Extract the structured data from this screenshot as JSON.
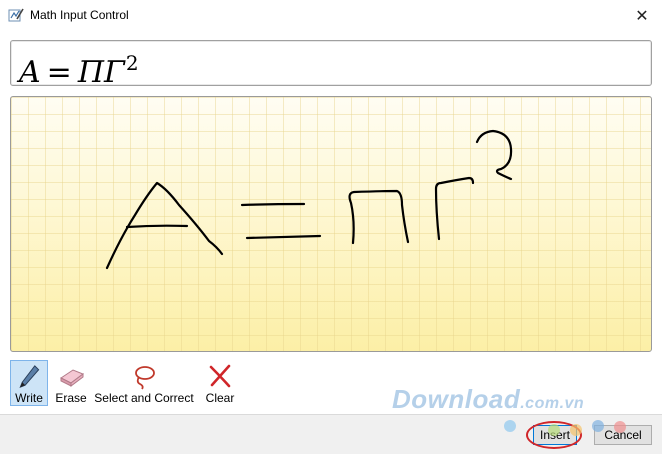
{
  "window": {
    "title": "Math Input Control",
    "close_glyph": "✕",
    "icons": [
      "math-input-app-icon",
      "close-icon"
    ]
  },
  "preview": {
    "var_a": "A",
    "equals": "=",
    "pi": "Π",
    "gamma": "Γ",
    "exponent": "2"
  },
  "handwriting": {
    "icon": "handwritten-ink-strokes",
    "ink_color": "#000000"
  },
  "toolbar": {
    "tools": [
      {
        "label": "Write",
        "icon": "pen-icon",
        "active": true
      },
      {
        "label": "Erase",
        "icon": "eraser-icon",
        "active": false
      },
      {
        "label": "Select and Correct",
        "icon": "lasso-icon",
        "active": false
      },
      {
        "label": "Clear",
        "icon": "clear-x-icon",
        "active": false
      }
    ]
  },
  "buttons": {
    "insert_label": "Insert",
    "cancel_label": "Cancel"
  },
  "watermark": {
    "brand": "Download",
    "domain": ".com.vn"
  },
  "colors": {
    "canvas_background": "#fdf6c8",
    "active_tool": "#cde4f7",
    "highlight_ring": "#d0262a",
    "watermark": "#78aad7"
  }
}
